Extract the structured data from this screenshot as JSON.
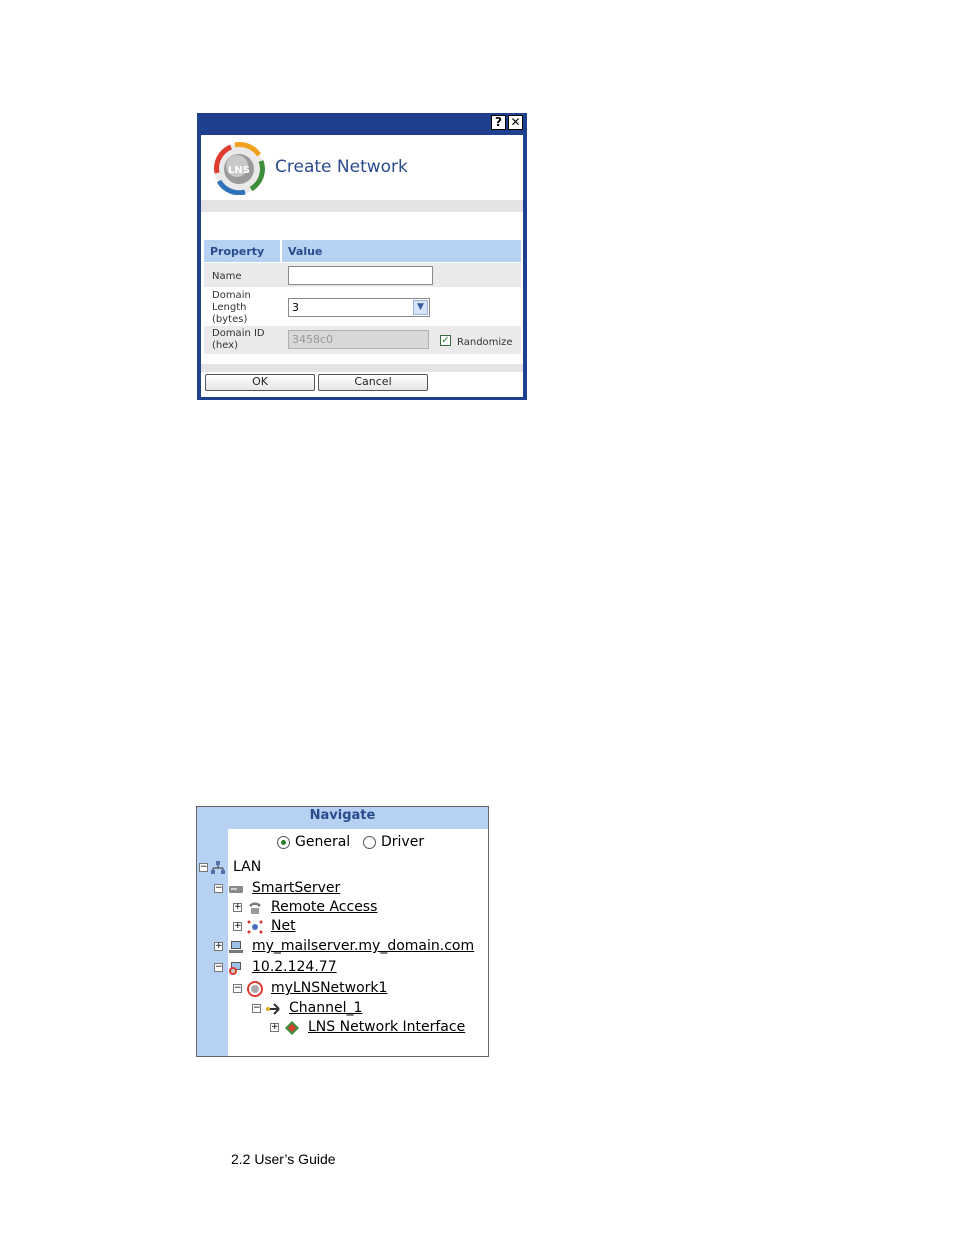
{
  "dialog": {
    "title": "Create Network",
    "help_label": "?",
    "close_label": "✕",
    "logo_text": "LNS",
    "table": {
      "header_property": "Property",
      "header_value": "Value",
      "rows": [
        {
          "label": "Name",
          "value": ""
        },
        {
          "label": "Domain Length (bytes)",
          "value": "3"
        },
        {
          "label": "Domain ID (hex)",
          "value": "3458c0"
        }
      ]
    },
    "randomize_label": "Randomize",
    "randomize_checked": true,
    "ok_label": "OK",
    "cancel_label": "Cancel"
  },
  "navigate": {
    "title": "Navigate",
    "radio_general": "General",
    "radio_driver": "Driver",
    "selected": "General",
    "tree": [
      {
        "label": "LAN",
        "expander": "−",
        "icon": "lan-icon",
        "link": false
      },
      {
        "label": "SmartServer",
        "expander": "−",
        "icon": "smartserver-icon",
        "link": true
      },
      {
        "label": "Remote Access",
        "expander": "+",
        "icon": "phone-icon",
        "link": true
      },
      {
        "label": "Net",
        "expander": "+",
        "icon": "net-icon",
        "link": true
      },
      {
        "label": "my_mailserver.my_domain.com",
        "expander": "+",
        "icon": "computer-icon",
        "link": true
      },
      {
        "label": "10.2.124.77",
        "expander": "−",
        "icon": "lns-server-icon",
        "link": true
      },
      {
        "label": "myLNSNetwork1",
        "expander": "−",
        "icon": "lns-network-icon",
        "link": true
      },
      {
        "label": "Channel_1",
        "expander": "−",
        "icon": "channel-icon",
        "link": true
      },
      {
        "label": "LNS Network Interface",
        "expander": "+",
        "icon": "network-interface-icon",
        "link": true
      }
    ]
  },
  "footer": {
    "text": "2.2 User’s Guide"
  }
}
